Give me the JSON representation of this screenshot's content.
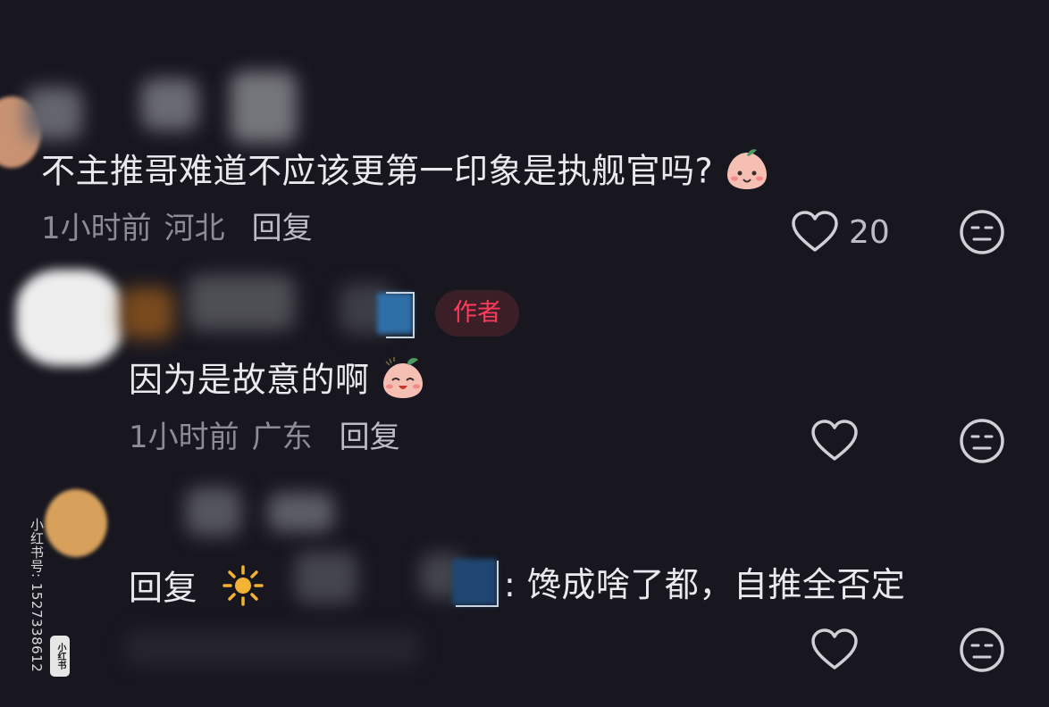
{
  "comments": [
    {
      "text": "不主推哥难道不应该更第一印象是执舰官吗?",
      "emoji": "peach-face-emoji",
      "time": "1小时前",
      "location": "河北",
      "reply_label": "回复",
      "likes": "20"
    },
    {
      "badge": "作者",
      "text": "因为是故意的啊",
      "emoji": "laughing-peach-emoji",
      "time": "1小时前",
      "location": "广东",
      "reply_label": "回复"
    },
    {
      "reply_prefix": "回复",
      "emoji": "sun-emoji",
      "text": ": 馋成啥了都，自推全否定"
    }
  ],
  "watermark": {
    "text": "小红书号: 1527338612",
    "logo": "小红书"
  },
  "colors": {
    "background": "#181720",
    "author_badge_bg": "#3a1f27",
    "author_badge_text": "#ff3b5c",
    "meta_text": "#8d8c96"
  }
}
